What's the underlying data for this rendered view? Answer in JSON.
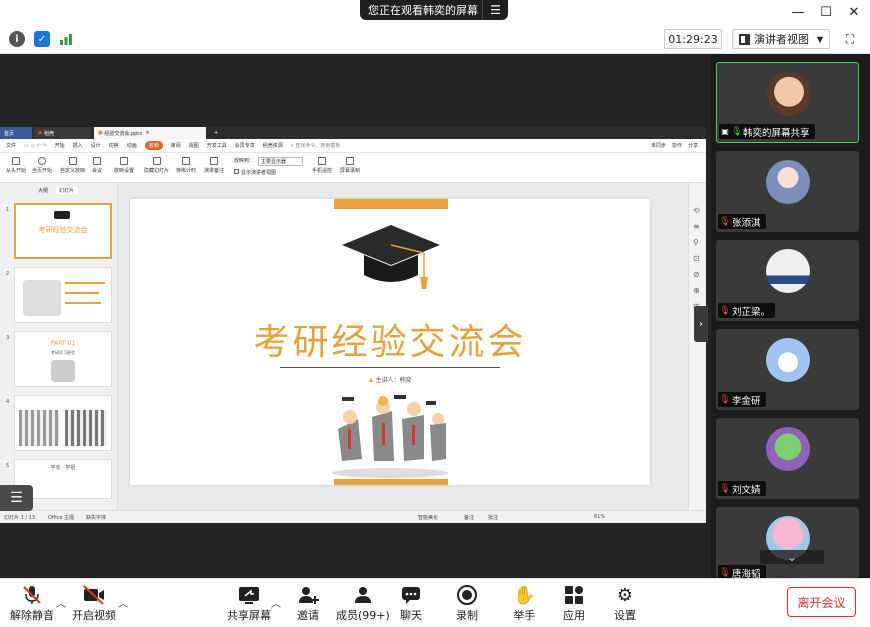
{
  "title_bar": {
    "share_status": "您正在观看韩奕的屏幕",
    "window_controls": [
      "minimize",
      "maximize",
      "close"
    ]
  },
  "info_bar": {
    "timer": "01:29:23",
    "view_mode": "演讲者视图"
  },
  "shared_screen": {
    "app_tabs": [
      "首页",
      "稻壳",
      "经验交流会.pptx"
    ],
    "menu_items": [
      "文件",
      "开始",
      "插入",
      "设计",
      "切换",
      "动画",
      "放映",
      "审阅",
      "视图",
      "开发工具",
      "会员专享",
      "稻壳资源"
    ],
    "active_menu": "放映",
    "search_hint": "查找命令、搜索模板",
    "right_menu": [
      "未同步",
      "协作",
      "分享"
    ],
    "toolbar_items": [
      "从头开始",
      "当页开始",
      "自定义放映",
      "会议",
      "放映设置",
      "隐藏幻灯片",
      "排练计时",
      "演讲备注",
      "放映到：",
      "主要显示器",
      "显示演讲者视图",
      "手机遥控",
      "屏幕录制"
    ],
    "left_tabs": [
      "大纲",
      "幻灯片"
    ],
    "slide_numbers": [
      "1",
      "2",
      "3",
      "4",
      "5"
    ],
    "thumb_titles": [
      "考研经验交流会",
      "PART 01",
      "考研学习经验",
      "学长 · 学姐"
    ],
    "slide": {
      "title": "考研经验交流会",
      "speaker": "主讲人：韩奕"
    },
    "status_bar": {
      "slide_count": "幻灯片 1 / 13",
      "theme": "Office 主题",
      "font_missing": "缺失字体",
      "smart_beautify": "智能美化",
      "notes": "备注",
      "comments": "批注",
      "zoom": "61%"
    }
  },
  "gallery": {
    "participants": [
      {
        "name": "韩奕的屏幕共享",
        "muted": false,
        "sharing": true,
        "avatar": "woman-photo",
        "color": "#c9856a"
      },
      {
        "name": "张添淇",
        "muted": true,
        "sharing": false,
        "avatar": "anime-girl",
        "color": "#8aa3c9"
      },
      {
        "name": "刘芷梁。",
        "muted": true,
        "sharing": false,
        "avatar": "white-car",
        "color": "#e8eaec"
      },
      {
        "name": "李金研",
        "muted": true,
        "sharing": false,
        "avatar": "sky-clouds",
        "color": "#a7c9ef"
      },
      {
        "name": "刘文婧",
        "muted": true,
        "sharing": false,
        "avatar": "green-character",
        "color": "#6db86d"
      },
      {
        "name": "唐海韬",
        "muted": true,
        "sharing": false,
        "avatar": "pink-flowers",
        "color": "#e99fc0"
      }
    ]
  },
  "bottom_bar": {
    "buttons": [
      {
        "label": "解除静音",
        "icon": "mic-muted-icon"
      },
      {
        "label": "开启视频",
        "icon": "video-off-icon"
      },
      {
        "label": "共享屏幕",
        "icon": "share-screen-icon"
      },
      {
        "label": "邀请",
        "icon": "invite-icon"
      },
      {
        "label": "成员(99+)",
        "icon": "members-icon"
      },
      {
        "label": "聊天",
        "icon": "chat-icon"
      },
      {
        "label": "录制",
        "icon": "record-icon"
      },
      {
        "label": "举手",
        "icon": "raise-hand-icon"
      },
      {
        "label": "应用",
        "icon": "apps-icon"
      },
      {
        "label": "设置",
        "icon": "settings-icon"
      }
    ],
    "leave_label": "离开会议"
  }
}
